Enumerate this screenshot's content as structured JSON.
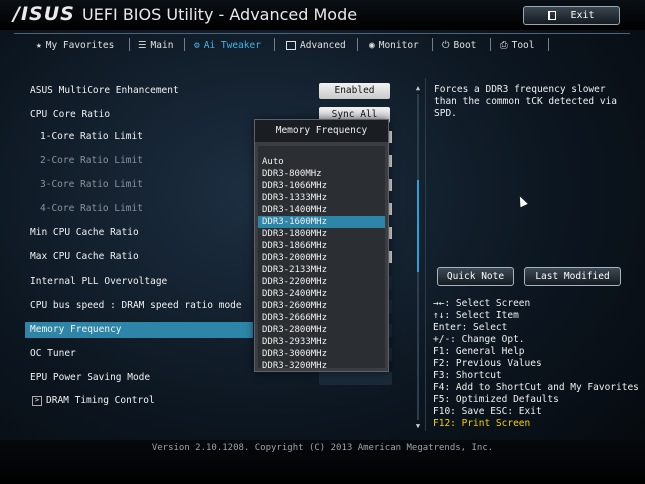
{
  "header": {
    "logo": "/ISUS",
    "title": "UEFI BIOS Utility - Advanced Mode",
    "exit_label": "Exit"
  },
  "tabs": [
    {
      "label": "My Favorites",
      "icon": "star-icon"
    },
    {
      "label": "Main",
      "icon": "list-icon"
    },
    {
      "label": "Ai Tweaker",
      "icon": "tweaker-icon"
    },
    {
      "label": "Advanced",
      "icon": "advanced-icon"
    },
    {
      "label": "Monitor",
      "icon": "monitor-icon"
    },
    {
      "label": "Boot",
      "icon": "power-icon"
    },
    {
      "label": "Tool",
      "icon": "tool-icon"
    }
  ],
  "settings": [
    {
      "label": "ASUS MultiCore Enhancement",
      "value": "Enabled"
    },
    {
      "label": "CPU Core Ratio",
      "value": "Sync All Cores"
    },
    {
      "label": "1-Core Ratio Limit",
      "value": ""
    },
    {
      "label": "2-Core Ratio Limit",
      "value": ""
    },
    {
      "label": "3-Core Ratio Limit",
      "value": ""
    },
    {
      "label": "4-Core Ratio Limit",
      "value": ""
    },
    {
      "label": "Min CPU Cache Ratio",
      "value": ""
    },
    {
      "label": "Max CPU Cache Ratio",
      "value": ""
    },
    {
      "label": "Internal PLL Overvoltage",
      "value": ""
    },
    {
      "label": "CPU bus speed : DRAM speed ratio mode",
      "value": ""
    },
    {
      "label": "Memory Frequency",
      "value": ""
    },
    {
      "label": "OC Tuner",
      "value": ""
    },
    {
      "label": "EPU Power Saving Mode",
      "value": ""
    },
    {
      "label": "DRAM Timing Control",
      "value": ""
    }
  ],
  "popup": {
    "title": "Memory Frequency",
    "options": [
      "Auto",
      "DDR3-800MHz",
      "DDR3-1066MHz",
      "DDR3-1333MHz",
      "DDR3-1400MHz",
      "DDR3-1600MHz",
      "DDR3-1800MHz",
      "DDR3-1866MHz",
      "DDR3-2000MHz",
      "DDR3-2133MHz",
      "DDR3-2200MHz",
      "DDR3-2400MHz",
      "DDR3-2600MHz",
      "DDR3-2666MHz",
      "DDR3-2800MHz",
      "DDR3-2933MHz",
      "DDR3-3000MHz",
      "DDR3-3200MHz"
    ],
    "selected": "DDR3-1600MHz"
  },
  "help": {
    "text": "Forces a DDR3 frequency slower than the common tCK detected via SPD.",
    "quick_note": "Quick Note",
    "last_modified": "Last Modified"
  },
  "keys": [
    "→←: Select Screen",
    "↑↓: Select Item",
    "Enter: Select",
    "+/-: Change Opt.",
    "F1: General Help",
    "F2: Previous Values",
    "F3: Shortcut",
    "F4: Add to ShortCut and My Favorites",
    "F5: Optimized Defaults",
    "F10: Save  ESC: Exit",
    "F12: Print Screen"
  ],
  "footer": "Version 2.10.1208. Copyright (C) 2013 American Megatrends, Inc.",
  "colors": {
    "accent": "#2d86a8",
    "active_tab": "#3fb6e6",
    "key_highlight": "#f7d300"
  }
}
